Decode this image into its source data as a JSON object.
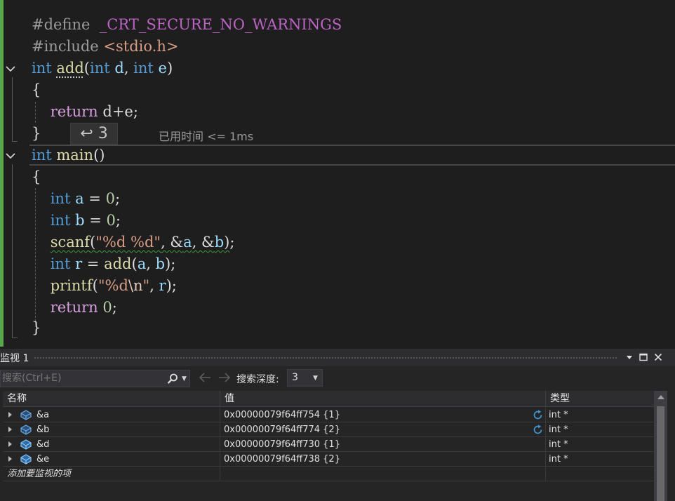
{
  "editor": {
    "code": {
      "l1_define": "#define",
      "l1_macro": "_CRT_SECURE_NO_WARNINGS",
      "l2_include": "#include",
      "l2_header": "<stdio.h>",
      "kw_int": "int",
      "kw_return": "return",
      "fn_add": "add",
      "fn_main": "main",
      "fn_scanf": "scanf",
      "fn_printf": "printf",
      "param_d": "d",
      "param_e": "e",
      "var_a": "a",
      "var_b": "b",
      "var_r": "r",
      "num_zero": "0",
      "fmt_scanf": "\"%d %d\"",
      "fmt_printf_1": "\"%d",
      "fmt_printf_esc": "\\n",
      "fmt_printf_2": "\"",
      "brace_open": "{",
      "brace_close": "}",
      "return_expr": "d+e;"
    },
    "step_chip": "↩ 3",
    "elapsed": "已用时间 <= 1ms"
  },
  "watch": {
    "title": "监视 1",
    "search_placeholder": "搜索(Ctrl+E)",
    "depth_label": "搜索深度:",
    "depth_value": "3",
    "columns": {
      "name": "名称",
      "value": "值",
      "type": "类型"
    },
    "rows": [
      {
        "name": "&a",
        "value": "0x00000079f64ff754 {1}",
        "type": "int *",
        "refresh": true
      },
      {
        "name": "&b",
        "value": "0x00000079f64ff774 {2}",
        "type": "int *",
        "refresh": true
      },
      {
        "name": "&d",
        "value": "0x00000079f64ff730 {1}",
        "type": "int *",
        "refresh": false
      },
      {
        "name": "&e",
        "value": "0x00000079f64ff738 {2}",
        "type": "int *",
        "refresh": false
      }
    ],
    "add_item": "添加要监视的项"
  },
  "colors": {
    "keyword": "#569cd6",
    "control": "#d8a0df",
    "function": "#dcdcaa",
    "string": "#d69d85",
    "number": "#b5cea8",
    "variable": "#9cdcfe",
    "change_bar": "#57a64a"
  },
  "icons": [
    "fold-chevron-icon",
    "step-back-icon",
    "search-icon",
    "arrow-left-icon",
    "arrow-right-icon",
    "dropdown-arrow-icon",
    "watch-object-icon",
    "refresh-icon",
    "window-position-icon",
    "maximize-icon",
    "close-icon"
  ]
}
